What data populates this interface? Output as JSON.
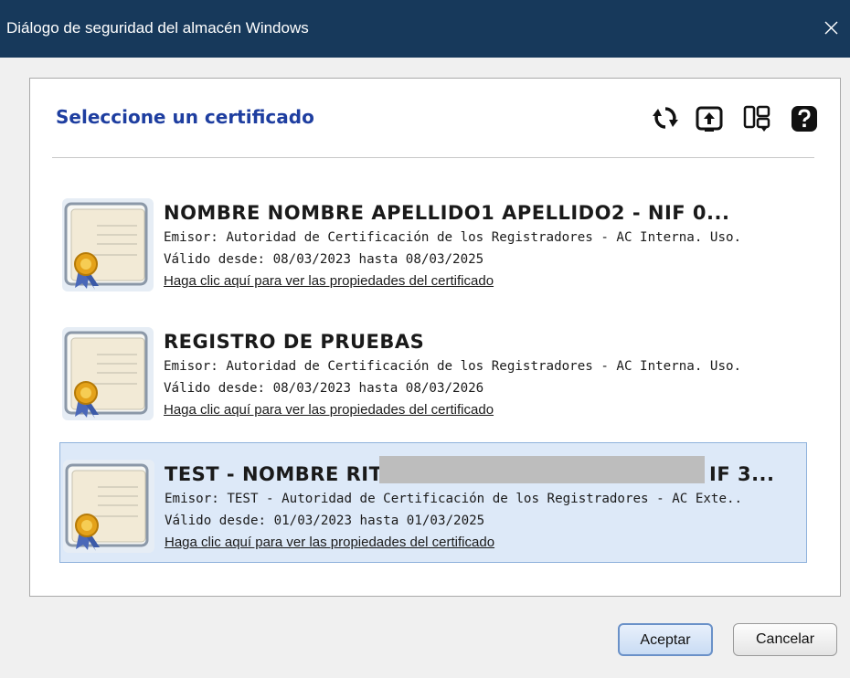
{
  "window": {
    "title": "Diálogo de seguridad del almacén Windows",
    "close_icon": "close-icon"
  },
  "dialog": {
    "heading": "Seleccione un certificado",
    "toolbar": [
      {
        "name": "refresh-icon"
      },
      {
        "name": "import-icon"
      },
      {
        "name": "view-icon"
      },
      {
        "name": "help-icon"
      }
    ]
  },
  "certificates": [
    {
      "name": "NOMBRE NOMBRE APELLIDO1 APELLIDO2 - NIF 0...",
      "issuer": "Emisor: Autoridad de Certificación de los Registradores - AC Interna. Uso.",
      "validity": "Válido desde: 08/03/2023 hasta 08/03/2025",
      "link": "Haga clic aquí para ver las propiedades del certificado",
      "selected": false
    },
    {
      "name": "REGISTRO DE PRUEBAS",
      "issuer": "Emisor: Autoridad de Certificación de los Registradores - AC Interna. Uso.",
      "validity": "Válido desde: 08/03/2023 hasta 08/03/2026",
      "link": "Haga clic aquí para ver las propiedades del certificado",
      "selected": false
    },
    {
      "name": "TEST - NOMBRE RIT/",
      "name_tail": "IF 3...",
      "issuer": "Emisor: TEST - Autoridad de Certificación de los Registradores - AC Exte..",
      "validity": "Válido desde: 01/03/2023 hasta 01/03/2025",
      "link": "Haga clic aquí para ver las propiedades del certificado",
      "selected": true
    }
  ],
  "buttons": {
    "ok": "Aceptar",
    "cancel": "Cancelar"
  },
  "colors": {
    "titlebar": "#17395b",
    "heading": "#1e3ea0",
    "selected_bg": "#dde9f8"
  }
}
